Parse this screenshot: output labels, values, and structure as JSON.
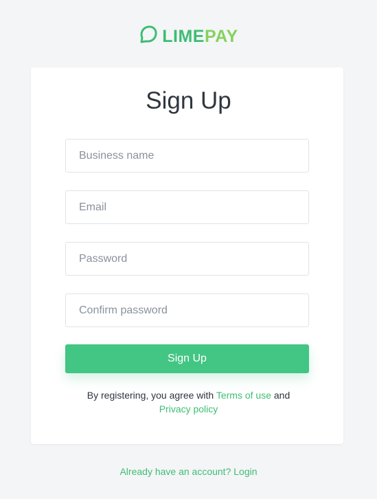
{
  "brand": {
    "name_part1": "LIME",
    "name_part2": "PAY",
    "icon": "lime-logo-icon",
    "colors": {
      "primary": "#3dbd73",
      "secondary": "#86d25d"
    }
  },
  "form": {
    "title": "Sign Up",
    "fields": {
      "business_name": {
        "placeholder": "Business name",
        "value": ""
      },
      "email": {
        "placeholder": "Email",
        "value": ""
      },
      "password": {
        "placeholder": "Password",
        "value": ""
      },
      "confirm_password": {
        "placeholder": "Confirm password",
        "value": ""
      }
    },
    "submit_label": "Sign Up",
    "submit_color": "#43c584"
  },
  "terms": {
    "prefix": "By registering, you agree with",
    "terms_link": "Terms of use",
    "conjunction": "and",
    "privacy_link": "Privacy policy"
  },
  "footer": {
    "login_prompt": "Already have an account? Login"
  }
}
